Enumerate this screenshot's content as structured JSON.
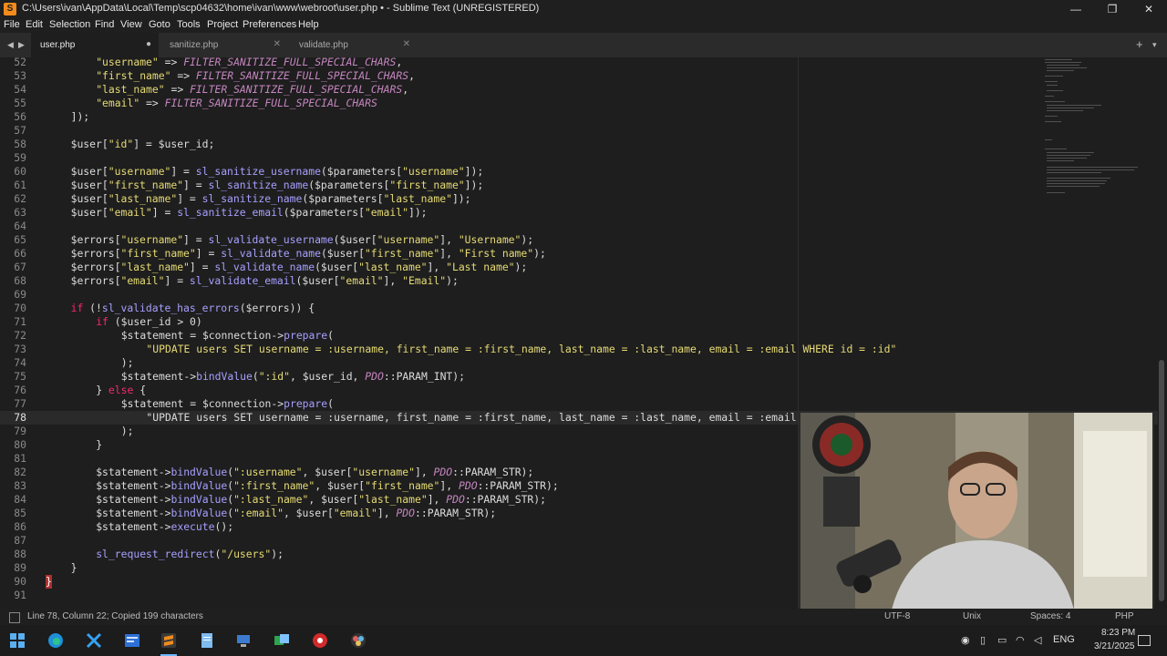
{
  "window": {
    "title": "C:\\Users\\ivan\\AppData\\Local\\Temp\\scp04632\\home\\ivan\\www\\webroot\\user.php • - Sublime Text (UNREGISTERED)",
    "app_icon": "S",
    "minimize": "—",
    "maximize": "❐",
    "close": "✕"
  },
  "menu": [
    "File",
    "Edit",
    "Selection",
    "Find",
    "View",
    "Goto",
    "Tools",
    "Project",
    "Preferences",
    "Help"
  ],
  "tabs": [
    {
      "label": "user.php",
      "close": "●"
    },
    {
      "label": "sanitize.php",
      "close": "✕"
    },
    {
      "label": "validate.php",
      "close": "✕"
    }
  ],
  "tab_nav": {
    "back": "◀",
    "forward": "▶",
    "new_tab": "+",
    "more": "▾"
  },
  "lines": [
    {
      "n": "52",
      "text": "\"username\" => FILTER_SANITIZE_FULL_SPECIAL_CHARS,"
    },
    {
      "n": "53",
      "text": "\"first_name\" => FILTER_SANITIZE_FULL_SPECIAL_CHARS,"
    },
    {
      "n": "54",
      "text": "\"last_name\" => FILTER_SANITIZE_FULL_SPECIAL_CHARS,"
    },
    {
      "n": "55",
      "text": "\"email\" => FILTER_SANITIZE_FULL_SPECIAL_CHARS"
    },
    {
      "n": "56",
      "text": "]);"
    },
    {
      "n": "57",
      "text": ""
    },
    {
      "n": "58",
      "text": "$user[\"id\"] = $user_id;"
    },
    {
      "n": "59",
      "text": ""
    },
    {
      "n": "60",
      "text": "$user[\"username\"] = sl_sanitize_username($parameters[\"username\"]);"
    },
    {
      "n": "61",
      "text": "$user[\"first_name\"] = sl_sanitize_name($parameters[\"first_name\"]);"
    },
    {
      "n": "62",
      "text": "$user[\"last_name\"] = sl_sanitize_name($parameters[\"last_name\"]);"
    },
    {
      "n": "63",
      "text": "$user[\"email\"] = sl_sanitize_email($parameters[\"email\"]);"
    },
    {
      "n": "64",
      "text": ""
    },
    {
      "n": "65",
      "text": "$errors[\"username\"] = sl_validate_username($user[\"username\"], \"Username\");"
    },
    {
      "n": "66",
      "text": "$errors[\"first_name\"] = sl_validate_name($user[\"first_name\"], \"First name\");"
    },
    {
      "n": "67",
      "text": "$errors[\"last_name\"] = sl_validate_name($user[\"last_name\"], \"Last name\");"
    },
    {
      "n": "68",
      "text": "$errors[\"email\"] = sl_validate_email($user[\"email\"], \"Email\");"
    },
    {
      "n": "69",
      "text": ""
    },
    {
      "n": "70",
      "text": "if (!sl_validate_has_errors($errors)) {"
    },
    {
      "n": "71",
      "text": "if ($user_id > 0)"
    },
    {
      "n": "72",
      "text": "$statement = $connection->prepare("
    },
    {
      "n": "73",
      "text": "\"UPDATE users SET username = :username, first_name = :first_name, last_name = :last_name, email = :email WHERE id = :id\""
    },
    {
      "n": "74",
      "text": ");"
    },
    {
      "n": "75",
      "text": "$statement->bindValue(\":id\", $user_id, PDO::PARAM_INT);"
    },
    {
      "n": "76",
      "text": "} else {"
    },
    {
      "n": "77",
      "text": "$statement = $connection->prepare("
    },
    {
      "n": "78",
      "text": "\"UPDATE users SET username = :username, first_name = :first_name, last_name = :last_name, email = :email"
    },
    {
      "n": "79",
      "text": ");"
    },
    {
      "n": "80",
      "text": "}"
    },
    {
      "n": "81",
      "text": ""
    },
    {
      "n": "82",
      "text": "$statement->bindValue(\":username\", $user[\"username\"], PDO::PARAM_STR);"
    },
    {
      "n": "83",
      "text": "$statement->bindValue(\":first_name\", $user[\"first_name\"], PDO::PARAM_STR);"
    },
    {
      "n": "84",
      "text": "$statement->bindValue(\":last_name\", $user[\"last_name\"], PDO::PARAM_STR);"
    },
    {
      "n": "85",
      "text": "$statement->bindValue(\":email\", $user[\"email\"], PDO::PARAM_STR);"
    },
    {
      "n": "86",
      "text": "$statement->execute();"
    },
    {
      "n": "87",
      "text": ""
    },
    {
      "n": "88",
      "text": "sl_request_redirect(\"/users\");"
    },
    {
      "n": "89",
      "text": "}"
    },
    {
      "n": "90",
      "text": "}"
    },
    {
      "n": "91",
      "text": ""
    }
  ],
  "status": {
    "position": "Line 78, Column 22; Copied 199 characters",
    "encoding": "UTF-8",
    "line_endings": "Unix",
    "indent": "Spaces: 4",
    "syntax": "PHP"
  },
  "taskbar": {
    "language": "ENG",
    "time": "8:23 PM",
    "date": "3/21/2025"
  },
  "colors": {
    "string": "#e6db74",
    "variable": "#dcdcdc",
    "function": "#a6a0ff",
    "operator": "#f92672",
    "constant": "#c586c0",
    "accent": "#f28b1c"
  }
}
